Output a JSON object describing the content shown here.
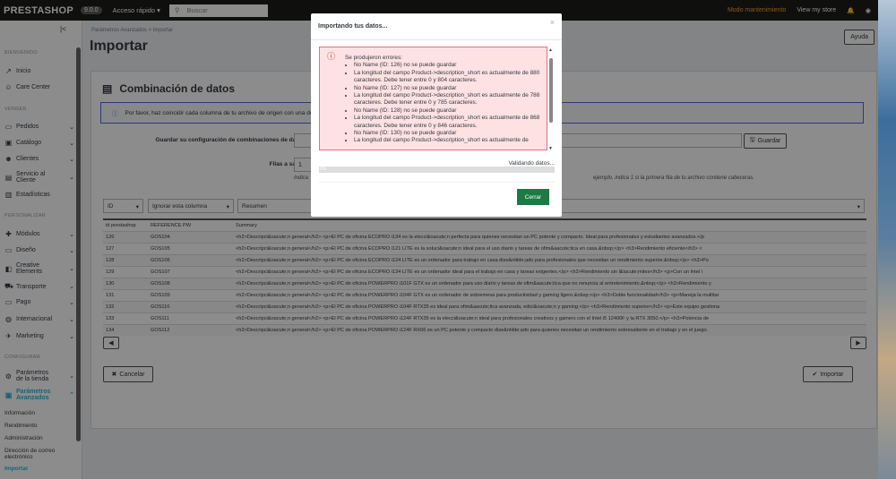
{
  "topbar": {
    "logo": "PRESTASHOP",
    "version": "9.0.0",
    "quick_access": "Acceso rápido ▾",
    "search_placeholder": "Buscar",
    "maintenance": "Modo mantenimiento",
    "view_store": "View my store"
  },
  "sidebar": {
    "sections": [
      "BIENVENIDO",
      "VENDER",
      "PERSONALIZAR",
      "CONFIGURAR"
    ],
    "items": [
      "Inicio",
      "Care Center",
      "Pedidos",
      "Catálogo",
      "Clientes",
      "Servicio al Cliente",
      "Estadísticas",
      "Módulos",
      "Diseño",
      "Creative Elements",
      "Transporte",
      "Pago",
      "Internacional",
      "Marketing",
      "Parámetros de la tienda",
      "Parámetros Avanzados"
    ],
    "subitems": [
      "Información",
      "Rendimiento",
      "Administración",
      "Dirección de correo electrónico",
      "Importar"
    ]
  },
  "header": {
    "breadcrumb": "Parámetros Avanzados  >  Importar",
    "title": "Importar",
    "help": "Ayuda"
  },
  "card": {
    "title": "Combinación de datos",
    "info": "Por favor, haz coincidir cada columna de tu archivo de origen con una de las columnas de destino.",
    "save_config_label": "Guardar su configuración de combinaciones de datos",
    "save_button": "Guardar",
    "rows_skip_label": "Filas a saltar",
    "rows_skip_value": "1",
    "help_left": "Indica",
    "help_right": "ejemplo, indica 1 si la primera fila de tu archivo contiene cabeceras.",
    "selects": [
      "ID",
      "Ignorar esta columna",
      "Resumen"
    ],
    "columns": [
      "id prestashop",
      "REFERENCE PW",
      "Summary"
    ],
    "rows": [
      [
        "126",
        "GOS104",
        "<h2>Descripci&oacute;n general</h2> <p>El PC de oficina ECOPRO i134 es la elecci&oacute;n perfecta para quienes necesitan un PC potente y compacto. Ideal para profesionales y estudiantes avanzados.</p"
      ],
      [
        "127",
        "GOS105",
        "<h2>Descripci&oacute;n general</h2> <p>El PC de oficina ECOPRO i121 LITE es la soluci&oacute;n ideal para el uso diario y tareas de ofim&aacute;tica en casa.&nbsp;</p> <h3>Rendimiento eficiente</h3> <"
      ],
      [
        "128",
        "GOS106",
        "<h2>Descripci&oacute;n general</h2> <p>El PC de oficina ECOPRO i124 LITE es un ordenador para trabajo en casa dise&ntilde;ado para profesionales que necesitan un rendimiento superior.&nbsp;</p> <h3>Po"
      ],
      [
        "129",
        "GOS107",
        "<h2>Descripci&oacute;n general</h2> <p>El PC de oficina ECOPRO i134 LITE es un ordenador ideal para el trabajo en casa y tareas exigentes.</p> <h3>Rendimiento sin l&iacute;mites</h3> <p>Con un Intel i"
      ],
      [
        "130",
        "GOS108",
        "<h2>Descripci&oacute;n general</h2> <p>El PC de oficina POWERPRO i101F GTX es un ordenador para uso diario y tareas de ofim&aacute;tica que no renuncia al entretenimiento.&nbsp;</p> <h3>Rendimiento y"
      ],
      [
        "131",
        "GOS109",
        "<h2>Descripci&oacute;n general</h2> <p>El PC de oficina POWERPRO i104F GTX es un ordenador de sobremesa para productividad y gaming ligero.&nbsp;</p> <h3>Doble funcionalidad</h3> <p>Maneja la multitar"
      ],
      [
        "132",
        "GOS110",
        "<h2>Descripci&oacute;n general</h2> <p>El PC de oficina POWERPRO i104F RTX35 es ideal para ofim&aacute;tica avanzada, edici&oacute;n y gaming.</p> <h3>Rendimiento superior</h3> <p>Este equipo gestiona"
      ],
      [
        "133",
        "GOS111",
        "<h2>Descripci&oacute;n general</h2> <p>El PC de oficina POWERPRO i124F RTX35 es la elecci&oacute;n ideal para profesionales creativos y gamers con el Intel i5 12400F y la RTX 3050.</p> <h3>Potencia de"
      ],
      [
        "134",
        "GOS112",
        "<h2>Descripci&oacute;n general</h2> <p>El PC de oficina POWERPRO i124F RX66 es un PC potente y compacto dise&ntilde;ado para quienes necesitan un rendimiento sobresaliente en el trabajo y en el juego."
      ]
    ],
    "cancel": "Cancelar",
    "import": "Importar"
  },
  "modal": {
    "title": "Importando tus datos...",
    "errors_heading": "Se produjeron errores:",
    "errors": [
      "No Name (ID: 126) no se puede guardar",
      "La longitud del campo Product->description_short es actualmente de 880 caracteres. Debe tener entre 0 y 804 caracteres.",
      "No Name (ID: 127) no se puede guardar",
      "La longitud del campo Product->description_short es actualmente de 788 caracteres. Debe tener entre 0 y 785 caracteres.",
      "No Name (ID: 128) no se puede guardar",
      "La longitud del campo Product->description_short es actualmente de 868 caracteres. Debe tener entre 0 y 846 caracteres.",
      "No Name (ID: 130) no se puede guardar",
      "La longitud del campo Product->description_short es actualmente de"
    ],
    "status": "Validando datos...",
    "progress": "0%",
    "close": "Cerrar"
  }
}
